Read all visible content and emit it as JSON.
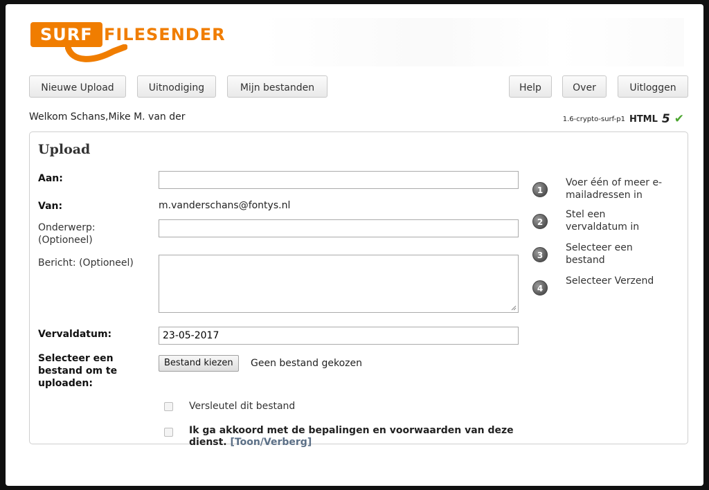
{
  "logo": {
    "brand": "SURF",
    "product": "FILESENDER"
  },
  "nav": {
    "new_upload": "Nieuwe Upload",
    "invitation": "Uitnodiging",
    "my_files": "Mijn bestanden",
    "help": "Help",
    "about": "Over",
    "logout": "Uitloggen"
  },
  "welcome": "Welkom Schans,Mike M. van der",
  "version": {
    "text": "1.6-crypto-surf-p1",
    "html": "HTML",
    "five": "5"
  },
  "upload": {
    "title": "Upload",
    "to_label": "Aan:",
    "to_value": "",
    "from_label": "Van:",
    "from_value": "m.vanderschans@fontys.nl",
    "subject_label": "Onderwerp: (Optioneel)",
    "subject_value": "",
    "message_label": "Bericht: (Optioneel)",
    "message_value": "",
    "expiry_label": "Vervaldatum:",
    "expiry_value": "23-05-2017",
    "file_label": "Selecteer een bestand om te uploaden:",
    "file_button": "Bestand kiezen",
    "file_status": "Geen bestand gekozen",
    "encrypt_label": "Versleutel dit bestand",
    "terms_label": "Ik ga akkoord met de bepalingen en voorwaarden van deze dienst.",
    "terms_toggle": "[Toon/Verberg]"
  },
  "steps": [
    {
      "num": "1",
      "text": "Voer één of meer e-mailadressen in"
    },
    {
      "num": "2",
      "text": "Stel een vervaldatum in"
    },
    {
      "num": "3",
      "text": "Selecteer een bestand"
    },
    {
      "num": "4",
      "text": "Selecteer Verzend"
    }
  ],
  "colors": {
    "brand_orange": "#f07d00",
    "check_green": "#4aa52e",
    "link": "#5b6f86"
  }
}
